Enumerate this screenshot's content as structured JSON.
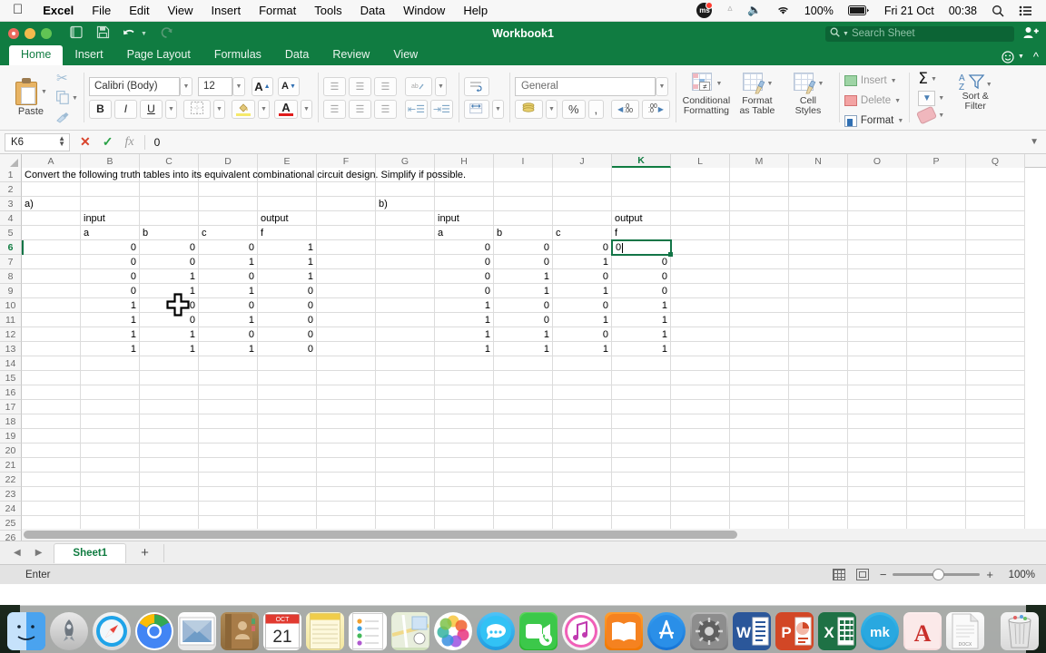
{
  "menubar": {
    "apple_icon": "apple-logo",
    "items": [
      "Excel",
      "File",
      "Edit",
      "View",
      "Insert",
      "Format",
      "Tools",
      "Data",
      "Window",
      "Help"
    ],
    "status": {
      "badge_label": "ms",
      "bluetooth_icon": "bluetooth-icon",
      "volume_icon": "volume-icon",
      "wifi_icon": "wifi-icon",
      "battery_percent": "100%",
      "battery_icon": "battery-charging-icon",
      "date": "Fri 21 Oct",
      "time": "00:38",
      "search_icon": "spotlight-search-icon",
      "control_center_icon": "control-center-icon"
    }
  },
  "titlebar": {
    "title": "Workbook1",
    "quick_access": [
      "new-sheet-icon",
      "save-icon",
      "undo-icon",
      "redo-icon"
    ],
    "search_placeholder": "Search Sheet",
    "share_icon": "add-user-icon",
    "smiley_icon": "smiley-feedback-icon",
    "collapse_ribbon_icon": "chevron-up-icon"
  },
  "ribbon": {
    "tabs": [
      {
        "label": "Home",
        "active": true
      },
      {
        "label": "Insert",
        "active": false
      },
      {
        "label": "Page Layout",
        "active": false
      },
      {
        "label": "Formulas",
        "active": false
      },
      {
        "label": "Data",
        "active": false
      },
      {
        "label": "Review",
        "active": false
      },
      {
        "label": "View",
        "active": false
      }
    ],
    "clipboard": {
      "paste_label": "Paste",
      "cut_icon": "scissors-icon",
      "copy_icon": "copy-icon",
      "format_painter_icon": "paintbrush-icon"
    },
    "font": {
      "family": "Calibri (Body)",
      "size": "12",
      "grow_label": "A",
      "shrink_label": "A",
      "bold_label": "B",
      "italic_label": "I",
      "underline_label": "U",
      "borders_icon": "borders-icon",
      "fill_color_icon": "fill-color-icon",
      "font_color_label": "A",
      "font_color": "#e01b1b",
      "fill_color": "#f5e96b"
    },
    "alignment": {
      "align_top_icon": "align-top-icon",
      "align_middle_icon": "align-middle-icon",
      "align_bottom_icon": "align-bottom-icon",
      "orientation_icon": "text-orientation-icon",
      "align_left_icon": "align-left-icon",
      "align_center_icon": "align-center-icon",
      "align_right_icon": "align-right-icon",
      "decrease_indent_icon": "decrease-indent-icon",
      "increase_indent_icon": "increase-indent-icon",
      "wrap_text_icon": "wrap-text-icon",
      "merge_icon": "merge-cells-icon"
    },
    "number": {
      "format": "General",
      "accounting_icon": "accounting-format-icon",
      "percent_label": "%",
      "comma_label": ",",
      "decrease_decimal_label": ".00",
      "increase_decimal_label": ".00"
    },
    "styles": {
      "conditional_formatting": "Conditional\nFormatting",
      "conditional_formatting_l1": "Conditional",
      "conditional_formatting_l2": "Formatting",
      "format_as_table_l1": "Format",
      "format_as_table_l2": "as Table",
      "cell_styles_l1": "Cell",
      "cell_styles_l2": "Styles"
    },
    "cells": {
      "insert_label": "Insert",
      "delete_label": "Delete",
      "format_label": "Format"
    },
    "editing": {
      "autosum_label": "Σ",
      "fill_icon": "fill-down-icon",
      "clear_icon": "clear-eraser-icon",
      "sort_filter_l1": "Sort &",
      "sort_filter_l2": "Filter"
    }
  },
  "formulabar": {
    "name_box": "K6",
    "cancel_icon": "cancel-x-icon",
    "confirm_icon": "confirm-check-icon",
    "function_icon": "insert-function-fx-icon",
    "value": "0"
  },
  "grid": {
    "columns": [
      "A",
      "B",
      "C",
      "D",
      "E",
      "F",
      "G",
      "H",
      "I",
      "J",
      "K",
      "L",
      "M",
      "N",
      "O",
      "P",
      "Q"
    ],
    "selected_column": "K",
    "rows": [
      1,
      2,
      3,
      4,
      5,
      6,
      7,
      8,
      9,
      10,
      11,
      12,
      13,
      14,
      15,
      16,
      17,
      18,
      19,
      20,
      21,
      22,
      23,
      24,
      25,
      26
    ],
    "selected_row": 6,
    "active_cell": "K6",
    "active_cell_value": "0",
    "cells": {
      "A1": "Convert the following truth tables into its equivalent combinational circuit design. Simplify if possible.",
      "A3": "a)",
      "G3": "b)",
      "B4": "input",
      "E4": "output",
      "H4": "input",
      "K4": "output",
      "B5": "a",
      "C5": "b",
      "D5": "c",
      "E5": "f",
      "H5": "a",
      "I5": "b",
      "J5": "c",
      "K5": "f",
      "B6": "0",
      "C6": "0",
      "D6": "0",
      "E6": "1",
      "B7": "0",
      "C7": "0",
      "D7": "1",
      "E7": "1",
      "B8": "0",
      "C8": "1",
      "D8": "0",
      "E8": "1",
      "B9": "0",
      "C9": "1",
      "D9": "1",
      "E9": "0",
      "B10": "1",
      "C10": "0",
      "D10": "0",
      "E10": "0",
      "B11": "1",
      "C11": "0",
      "D11": "1",
      "E11": "0",
      "B12": "1",
      "C12": "1",
      "D12": "0",
      "E12": "0",
      "B13": "1",
      "C13": "1",
      "D13": "1",
      "E13": "0",
      "H6": "0",
      "I6": "0",
      "J6": "0",
      "K6": "0",
      "H7": "0",
      "I7": "0",
      "J7": "1",
      "K7": "0",
      "H8": "0",
      "I8": "1",
      "J8": "0",
      "K8": "0",
      "H9": "0",
      "I9": "1",
      "J9": "1",
      "K9": "0",
      "H10": "1",
      "I10": "0",
      "J10": "0",
      "K10": "1",
      "H11": "1",
      "I11": "0",
      "J11": "1",
      "K11": "1",
      "H12": "1",
      "I12": "1",
      "J12": "0",
      "K12": "1",
      "H13": "1",
      "I13": "1",
      "J13": "1",
      "K13": "1"
    },
    "cursor_icon": "cell-crosshair-cursor"
  },
  "sheettabs": {
    "prev_icon": "previous-sheet-arrow",
    "next_icon": "next-sheet-arrow",
    "tabs": [
      "Sheet1"
    ],
    "add_label": "+"
  },
  "statusbar": {
    "mode": "Enter",
    "normal_view_icon": "normal-view-icon",
    "page_layout_icon": "page-layout-view-icon",
    "zoom_out_label": "−",
    "zoom_in_label": "+",
    "zoom_level": "100%"
  },
  "dock": {
    "items": [
      {
        "name": "finder",
        "glyph": "",
        "running": true
      },
      {
        "name": "launchpad",
        "glyph": "",
        "running": false
      },
      {
        "name": "safari",
        "glyph": "",
        "running": false
      },
      {
        "name": "chrome",
        "glyph": "",
        "running": true
      },
      {
        "name": "mail",
        "glyph": "",
        "running": false
      },
      {
        "name": "contacts",
        "glyph": "",
        "running": false
      },
      {
        "name": "calendar",
        "glyph": "21",
        "running": false
      },
      {
        "name": "notes",
        "glyph": "",
        "running": true
      },
      {
        "name": "reminders",
        "glyph": "",
        "running": false
      },
      {
        "name": "maps",
        "glyph": "",
        "running": false
      },
      {
        "name": "photos",
        "glyph": "",
        "running": false
      },
      {
        "name": "messages",
        "glyph": "",
        "running": false
      },
      {
        "name": "facetime",
        "glyph": "",
        "running": false
      },
      {
        "name": "itunes",
        "glyph": "",
        "running": false
      },
      {
        "name": "ibooks",
        "glyph": "",
        "running": false
      },
      {
        "name": "app-store",
        "glyph": "A",
        "running": false
      },
      {
        "name": "system-preferences",
        "glyph": "",
        "running": false
      },
      {
        "name": "microsoft-word",
        "glyph": "W",
        "running": true
      },
      {
        "name": "microsoft-powerpoint",
        "glyph": "P",
        "running": false
      },
      {
        "name": "microsoft-excel",
        "glyph": "X",
        "running": true
      },
      {
        "name": "mendeley",
        "glyph": "mk",
        "running": false
      },
      {
        "name": "acrobat",
        "glyph": "A",
        "running": false
      },
      {
        "name": "docx-file",
        "glyph": "DOCX",
        "running": false
      },
      {
        "name": "trash",
        "glyph": "",
        "running": false
      }
    ],
    "calendar_month": "OCT",
    "calendar_day": "21"
  }
}
